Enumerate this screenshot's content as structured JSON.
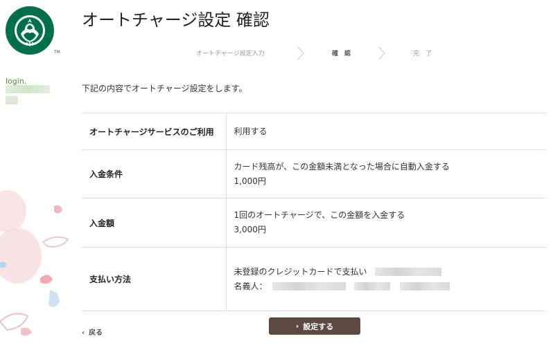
{
  "header": {
    "title": "オートチャージ設定 確認"
  },
  "sidebar": {
    "login_label": "login.",
    "tm": "TM"
  },
  "steps": [
    {
      "label": "オートチャージ設定入力",
      "state": "done"
    },
    {
      "label": "確　認",
      "state": "active"
    },
    {
      "label": "完　了",
      "state": "pending"
    }
  ],
  "intro": "下記の内容でオートチャージ設定をします。",
  "rows": [
    {
      "key": "オートチャージサービスのご利用",
      "lines": [
        "利用する"
      ]
    },
    {
      "key": "入金条件",
      "lines": [
        "カード残高が、この金額未満となった場合に自動入金する",
        "1,000円"
      ]
    },
    {
      "key": "入金額",
      "lines": [
        "1回のオートチャージで、この金額を入金する",
        "3,000円"
      ]
    },
    {
      "key": "支払い方法",
      "lines": [
        "未登録のクレジットカードで支払い",
        "名義人："
      ]
    }
  ],
  "footer": {
    "back_label": "戻る",
    "submit_label": "設定する"
  },
  "colors": {
    "brand_green": "#00704A",
    "button_brown": "#5c4a40",
    "login_green": "#4a8f2a"
  }
}
